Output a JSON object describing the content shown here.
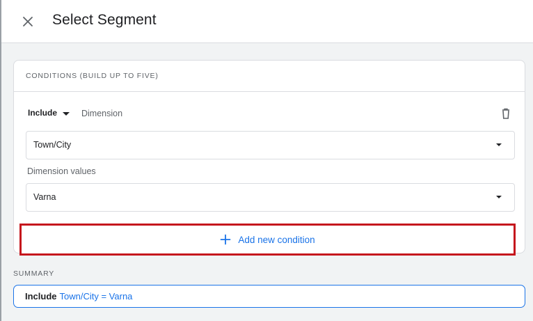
{
  "header": {
    "title": "Select Segment",
    "close_icon": "close-icon"
  },
  "conditions": {
    "heading": "CONDITIONS (BUILD UP TO FIVE)",
    "include_label": "Include",
    "dimension_label": "Dimension",
    "dimension_value": "Town/City",
    "dimension_values_label": "Dimension values",
    "dimension_values_value": "Varna",
    "add_condition_label": "Add new condition",
    "delete_icon": "trash-icon",
    "highlight_color": "#c5161d",
    "accent_color": "#1a73e8"
  },
  "summary": {
    "heading": "SUMMARY",
    "include": "Include",
    "condition": "Town/City = Varna"
  }
}
